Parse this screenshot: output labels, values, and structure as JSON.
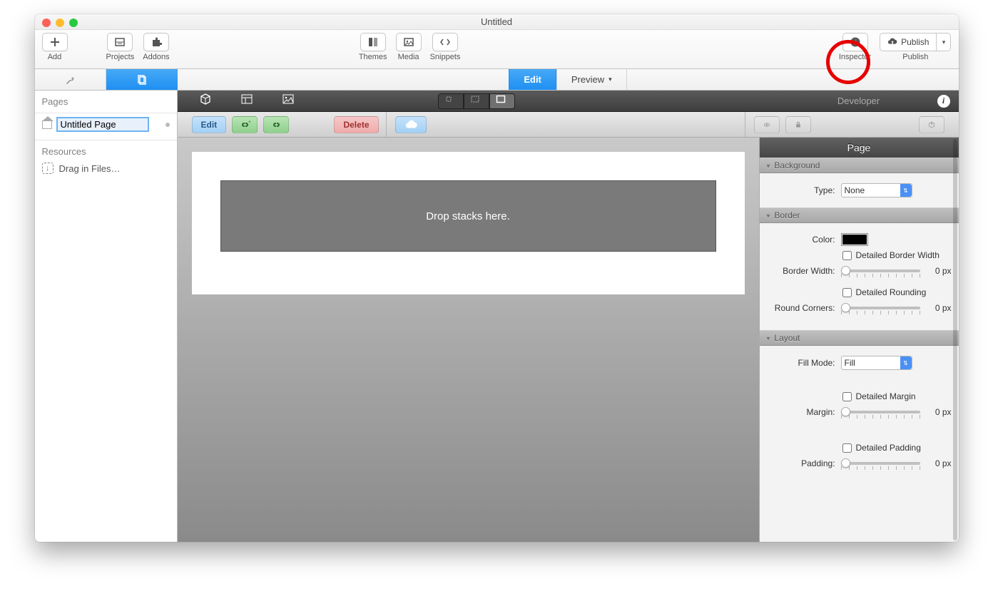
{
  "window": {
    "title": "Untitled"
  },
  "toolbar": {
    "add": "Add",
    "projects": "Projects",
    "addons": "Addons",
    "themes": "Themes",
    "media": "Media",
    "snippets": "Snippets",
    "inspector": "Inspector",
    "publish": "Publish",
    "publish_label": "Publish"
  },
  "segbar": {
    "edit": "Edit",
    "preview": "Preview"
  },
  "sidebar": {
    "pages_header": "Pages",
    "page_name": "Untitled Page",
    "resources_header": "Resources",
    "drag_files": "Drag in Files…"
  },
  "canvas": {
    "developer": "Developer",
    "edit_btn": "Edit",
    "delete_btn": "Delete",
    "drop_hint": "Drop stacks here."
  },
  "inspector": {
    "title": "Page",
    "sections": {
      "background": {
        "header": "Background",
        "type_label": "Type:",
        "type_value": "None"
      },
      "border": {
        "header": "Border",
        "color_label": "Color:",
        "detailed_border_width": "Detailed Border Width",
        "border_width_label": "Border Width:",
        "border_width_value": "0 px",
        "detailed_rounding": "Detailed Rounding",
        "round_corners_label": "Round Corners:",
        "round_corners_value": "0 px"
      },
      "layout": {
        "header": "Layout",
        "fill_mode_label": "Fill Mode:",
        "fill_mode_value": "Fill",
        "detailed_margin": "Detailed Margin",
        "margin_label": "Margin:",
        "margin_value": "0 px",
        "detailed_padding": "Detailed Padding",
        "padding_label": "Padding:",
        "padding_value": "0 px"
      }
    }
  }
}
